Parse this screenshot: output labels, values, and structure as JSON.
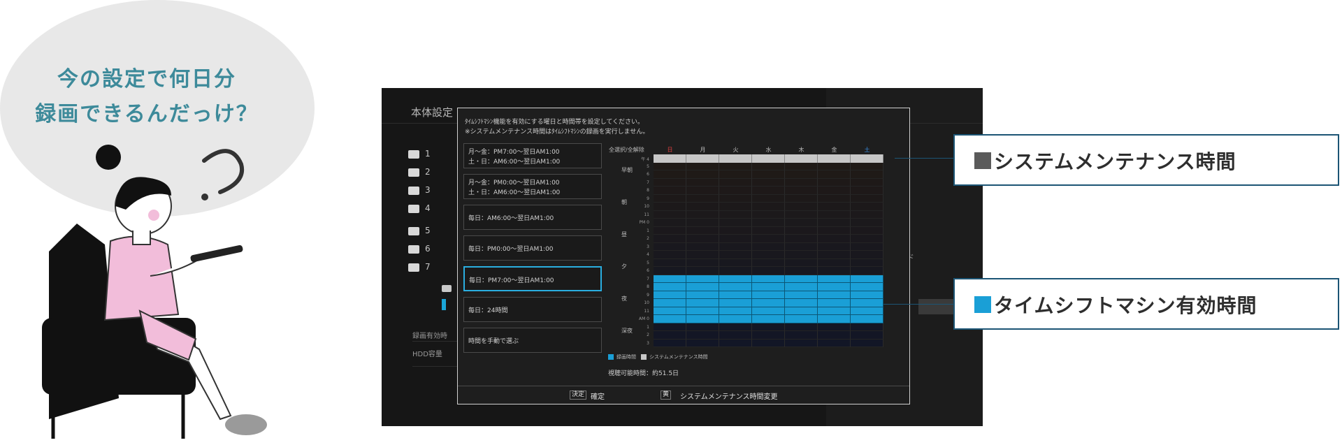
{
  "bubble": {
    "line1": "今の設定で何日分",
    "line2": "録画できるんだっけ？"
  },
  "tv": {
    "title": "本体設定",
    "background_rows": [
      "1",
      "2",
      "3",
      "4",
      "5",
      "6",
      "7"
    ],
    "background_labels": [
      "録画有効時",
      "HDD容量"
    ],
    "fragment": "ド"
  },
  "dialog": {
    "instruction_1": "ﾀｲﾑｼﾌﾄﾏｼﾝ機能を有効にする曜日と時間帯を設定してください。",
    "instruction_2": "※システムメンテナンス時間はﾀｲﾑｼﾌﾄﾏｼﾝの録画を実行しません。",
    "options": [
      {
        "lines": [
          "月～金：PM7:00～翌日AM1:00",
          "土・日：AM6:00～翌日AM1:00"
        ],
        "selected": false
      },
      {
        "lines": [
          "月～金：PM0:00～翌日AM1:00",
          "土・日：AM6:00～翌日AM1:00"
        ],
        "selected": false
      },
      {
        "lines": [
          "毎日：AM6:00～翌日AM1:00"
        ],
        "selected": false
      },
      {
        "lines": [
          "毎日：PM0:00～翌日AM1:00"
        ],
        "selected": false
      },
      {
        "lines": [
          "毎日：PM7:00～翌日AM1:00"
        ],
        "selected": true
      },
      {
        "lines": [
          "毎日：24時間"
        ],
        "selected": false
      },
      {
        "lines": [
          "時間を手動で選ぶ"
        ],
        "selected": false
      }
    ],
    "grid_header_label": "全選択/全解除",
    "days": [
      "日",
      "月",
      "火",
      "水",
      "木",
      "金",
      "土"
    ],
    "day_colors": [
      "#e04040",
      "#bbbbbb",
      "#bbbbbb",
      "#bbbbbb",
      "#bbbbbb",
      "#bbbbbb",
      "#3a8ee0"
    ],
    "time_of_day": [
      "早朝",
      "朝",
      "昼",
      "夕",
      "夜",
      "深夜"
    ],
    "hour_labels": [
      "4",
      "5",
      "6",
      "7",
      "8",
      "9",
      "10",
      "11",
      "0",
      "1",
      "2",
      "3",
      "4",
      "5",
      "6",
      "7",
      "8",
      "9",
      "10",
      "11",
      "0",
      "1",
      "2",
      "3"
    ],
    "hour_prefixes": {
      "0": "午 4",
      "8": "PM 0",
      "20": "AM 0"
    },
    "maintenance_hours": [
      0
    ],
    "timeshift_hours": [
      15,
      16,
      17,
      18,
      19,
      20
    ],
    "legend": {
      "timeshift": "録画時間",
      "maintenance": "システムメンテナンス時間"
    },
    "possible_time": "視聴可能時間：約51.5日",
    "footer": {
      "ok_key": "決定",
      "ok_label": "確定",
      "maint_key": "黄",
      "maint_label": "システムメンテナンス時間変更"
    }
  },
  "callouts": {
    "maintenance": {
      "label": "システムメンテナンス時間",
      "color": "#5a5a5a"
    },
    "timeshift": {
      "label": "タイムシフトマシン有効時間",
      "color": "#1a9fd6"
    }
  }
}
